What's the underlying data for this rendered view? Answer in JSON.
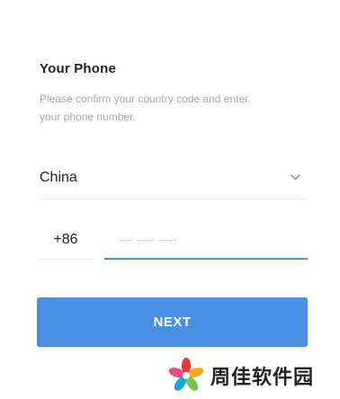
{
  "header": {
    "title": "Your Phone",
    "description": "Please confirm your country code and enter your phone number."
  },
  "country": {
    "selected": "China",
    "dropdown_icon": "chevron-down-icon"
  },
  "phone": {
    "country_code": "+86",
    "number_value": "",
    "number_placeholder": "--- ---- ----"
  },
  "actions": {
    "next_label": "NEXT"
  },
  "watermark": {
    "text": "周佳软件园",
    "logo_icon": "pinwheel-logo"
  },
  "colors": {
    "accent": "#4a90e2",
    "focus_underline": "#4a8fd9",
    "divider": "#ececec",
    "text_primary": "#222222",
    "text_secondary": "#a7a7a7"
  }
}
